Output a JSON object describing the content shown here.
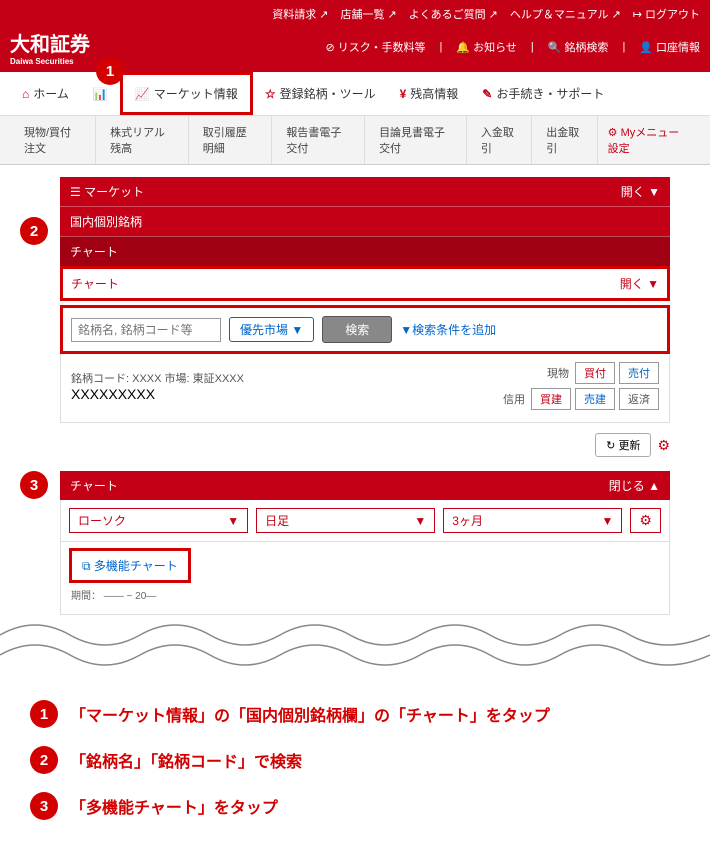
{
  "header": {
    "logo": "大和証券",
    "logo_sub": "Daiwa Securities",
    "top_links_1": [
      "資料請求",
      "店舗一覧",
      "よくあるご質問",
      "ヘルプ＆マニュアル",
      "ログアウト"
    ],
    "top_links_2": [
      "リスク・手数料等",
      "お知らせ",
      "銘柄検索",
      "口座情報"
    ]
  },
  "mainnav": {
    "home": "ホーム",
    "market": "マーケット情報",
    "registered": "登録銘柄・ツール",
    "balance": "残高情報",
    "procedures": "お手続き・サポート"
  },
  "subnav": {
    "items": [
      "現物/買付注文",
      "株式リアル残高",
      "取引履歴明細",
      "報告書電子交付",
      "目論見書電子交付",
      "入金取引",
      "出金取引"
    ],
    "mymenu": "Myメニュー設定"
  },
  "panel": {
    "market_title": "マーケット",
    "domestic": "国内個別銘柄",
    "chart_tab": "チャート",
    "open_label": "開く",
    "close_label": "閉じる",
    "chart_box": "チャート",
    "search_placeholder": "銘柄名, 銘柄コード等",
    "priority": "優先市場",
    "search_btn": "検索",
    "add_cond": "▼検索条件を追加",
    "stock_code": "銘柄コード: XXXX  市場: 東証XXXX",
    "stock_name": "XXXXXXXXX",
    "genbutsu": "現物",
    "shinyo": "信用",
    "buy": "買付",
    "sell": "売付",
    "buy_m": "買建",
    "sell_m": "売建",
    "hensai": "返済",
    "update": "更新",
    "chart_title": "チャート",
    "sel1": "ローソク",
    "sel2": "日足",
    "sel3": "3ヶ月",
    "multichart": "多機能チャート",
    "period": "期間："
  },
  "instructions": {
    "step1": "「マーケット情報」の「国内個別銘柄欄」の「チャート」をタップ",
    "step2": "「銘柄名」「銘柄コード」で検索",
    "step3": "「多機能チャート」をタップ"
  }
}
